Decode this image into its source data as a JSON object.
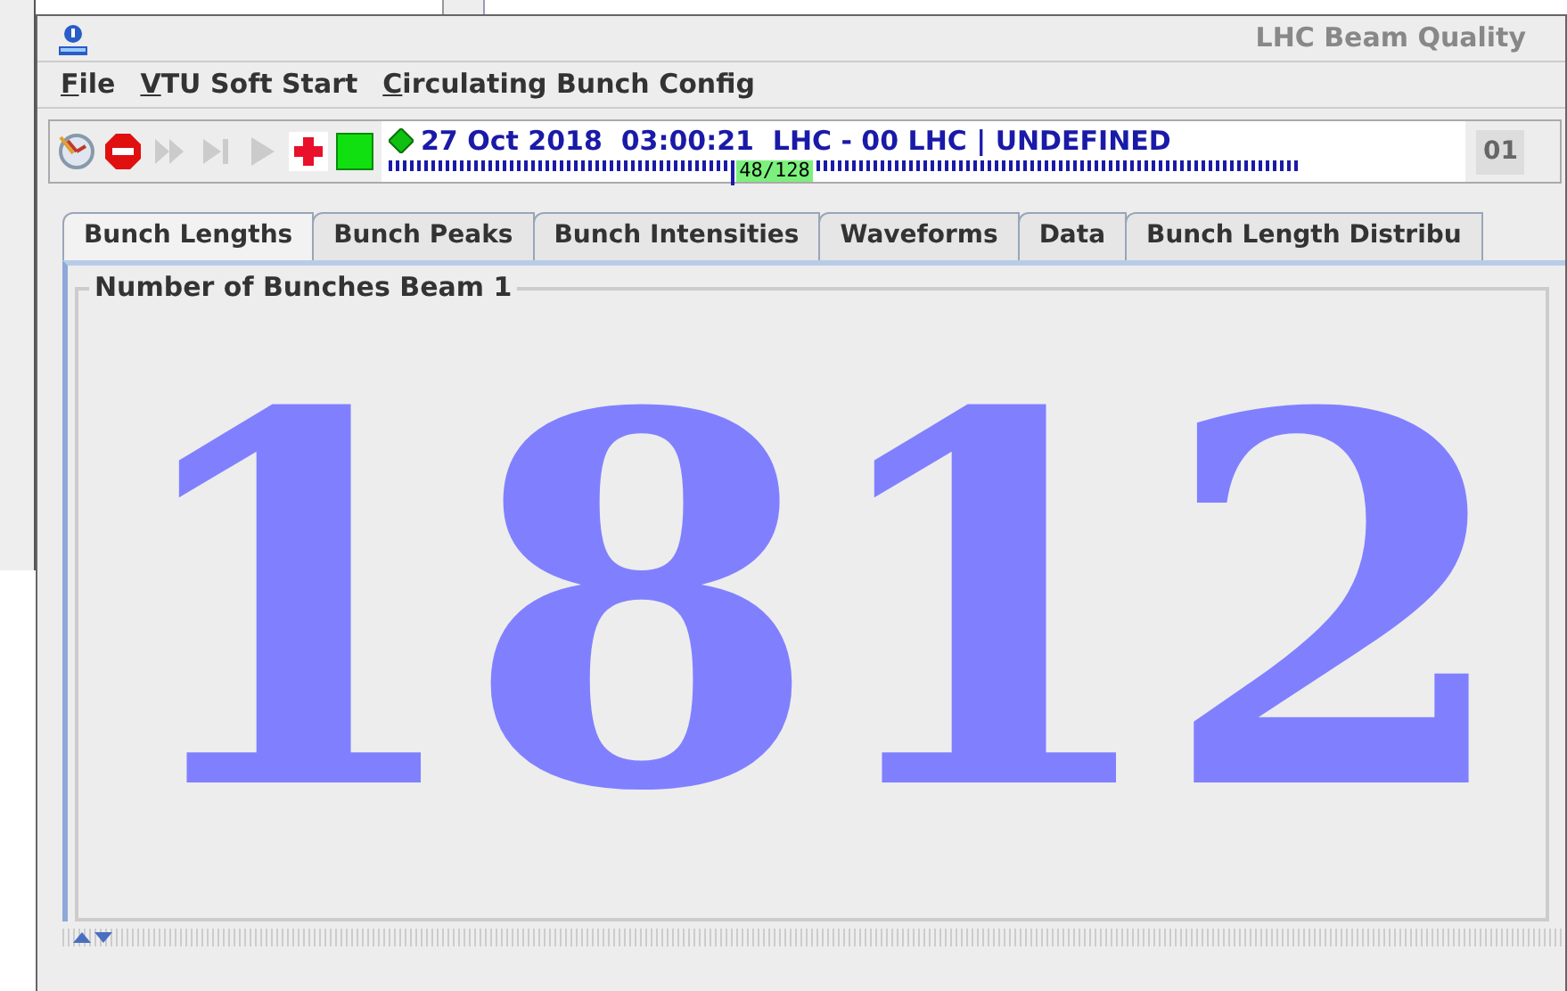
{
  "window": {
    "title": "LHC Beam Quality"
  },
  "menu": [
    {
      "label": "File"
    },
    {
      "label": "VTU Soft Start"
    },
    {
      "label": "Circulating Bunch Config"
    }
  ],
  "toolbar": [
    {
      "kind": "clock",
      "disabled": false
    },
    {
      "kind": "stop",
      "disabled": false
    },
    {
      "kind": "fast-forward",
      "disabled": true
    },
    {
      "kind": "step",
      "disabled": true
    },
    {
      "kind": "play",
      "disabled": true
    },
    {
      "kind": "add",
      "disabled": false
    },
    {
      "kind": "square",
      "disabled": false
    }
  ],
  "status": {
    "text": "27 Oct 2018  03:00:21  LHC - 00 LHC | UNDEFINED",
    "progress_label": "48/128",
    "level": 0.375
  },
  "counter": "01",
  "tabs": [
    {
      "label": "Bunch Lengths",
      "selected": true
    },
    {
      "label": "Bunch Peaks",
      "selected": false
    },
    {
      "label": "Bunch Intensities",
      "selected": false
    },
    {
      "label": "Waveforms",
      "selected": false
    },
    {
      "label": "Data",
      "selected": false
    },
    {
      "label": "Bunch Length Distribu",
      "selected": false
    }
  ],
  "panel": {
    "title": "Number of Bunches Beam 1",
    "value": "1812"
  }
}
